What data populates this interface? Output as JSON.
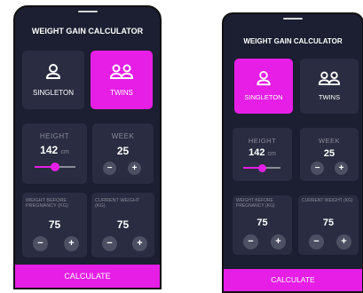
{
  "app": {
    "title": "WEIGHT GAIN CALCULATOR",
    "gender_options": [
      {
        "label": "SINGLETON",
        "icon": "person-icon"
      },
      {
        "label": "TWINS",
        "icon": "people-icon"
      }
    ],
    "height": {
      "label": "HEIGHT",
      "value": "142",
      "unit": "cm"
    },
    "week": {
      "label": "WEEK",
      "value": "25"
    },
    "weight_before": {
      "label": "WEIGHT BEFORE PREGNANCY (KG)",
      "value": "75"
    },
    "current_weight": {
      "label": "CURRENT WEIGHT (KG)",
      "value": "75"
    },
    "minus": "−",
    "plus": "+",
    "calculate": "CALCULATE"
  },
  "screens": [
    {
      "selected_gender": "TWINS",
      "height_fraction": 0.5
    },
    {
      "selected_gender": "SINGLETON",
      "height_fraction": 0.5
    }
  ],
  "colors": {
    "background": "#1c1e31",
    "card": "#2a2c41",
    "accent": "#e61ee6",
    "muted_text": "#8a8b99",
    "round_button": "#4d4f63"
  }
}
